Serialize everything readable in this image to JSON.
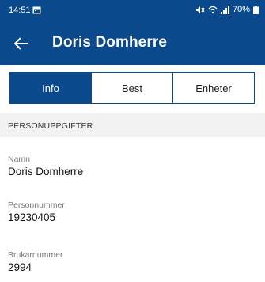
{
  "status_bar": {
    "time": "14:51",
    "battery": "70%",
    "icons": [
      "calendar-notification-icon",
      "mute-icon",
      "wifi-icon",
      "signal-icon",
      "battery-icon"
    ]
  },
  "app_bar": {
    "title": "Doris Domherre",
    "back_icon": "arrow-left-icon"
  },
  "tabs": [
    {
      "label": "Info",
      "active": true
    },
    {
      "label": "Best",
      "active": false
    },
    {
      "label": "Enheter",
      "active": false
    }
  ],
  "section": {
    "title": "PERSONUPPGIFTER"
  },
  "fields": [
    {
      "label": "Namn",
      "value": "Doris Domherre"
    },
    {
      "label": "Personnummer",
      "value": "19230405"
    },
    {
      "label": "Brukarnummer",
      "value": "2994"
    }
  ],
  "colors": {
    "primary": "#0a4a8c",
    "section_bg": "#f2f2f2"
  }
}
